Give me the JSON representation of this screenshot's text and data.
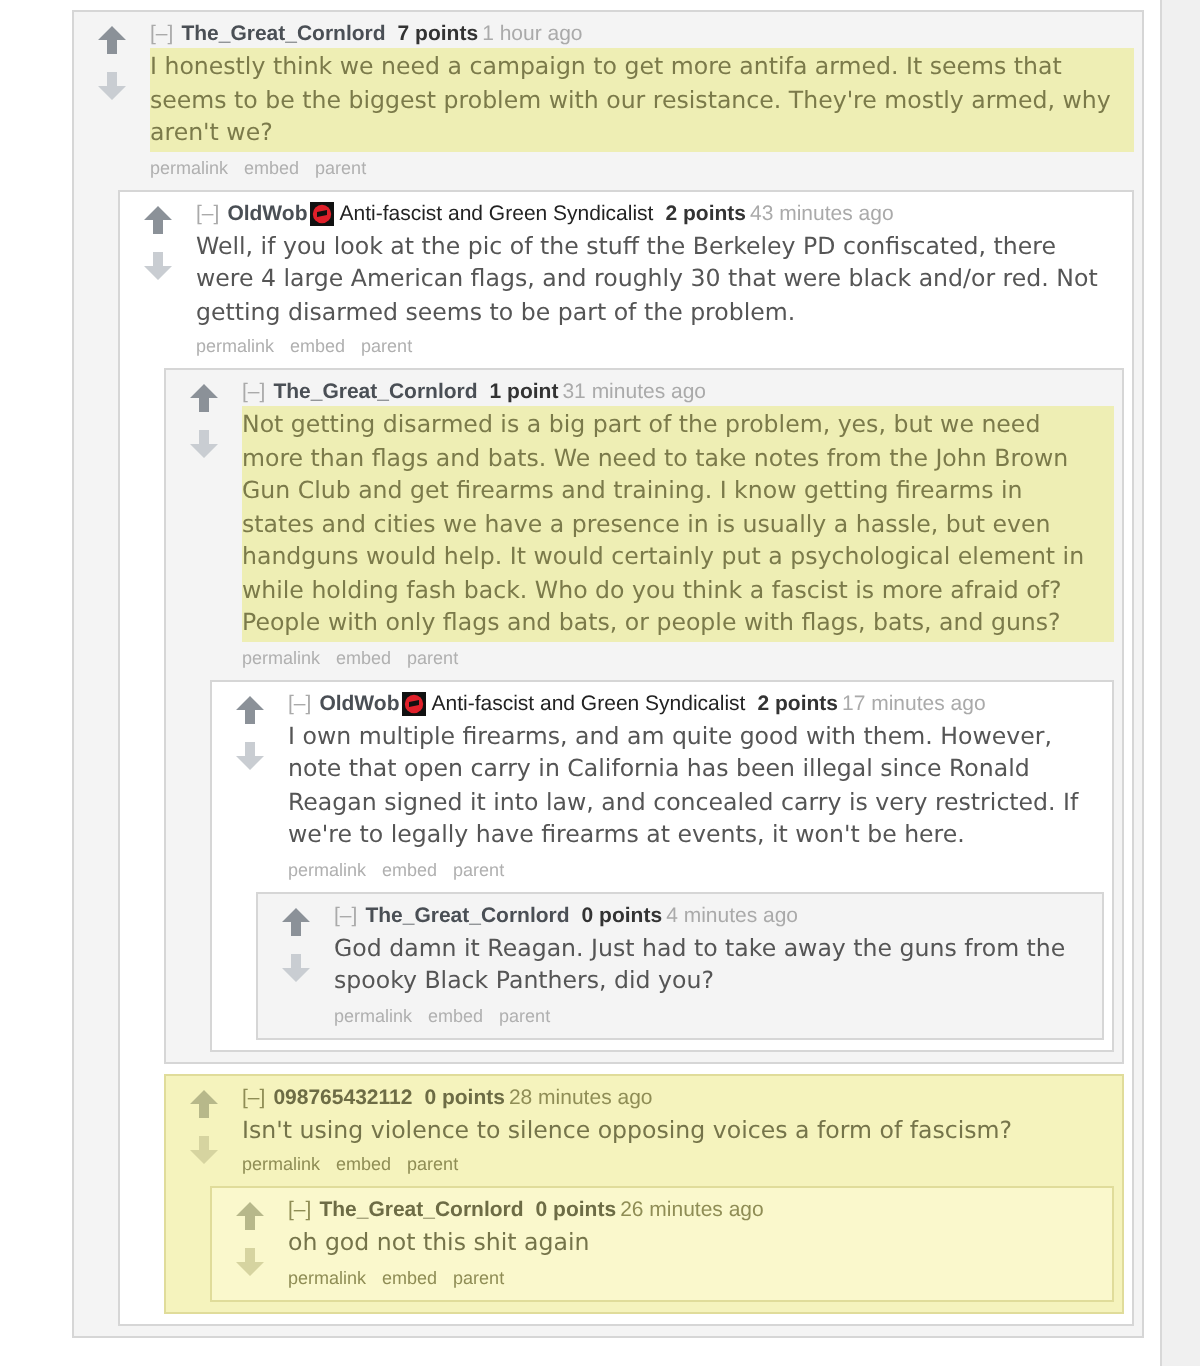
{
  "comments": [
    {
      "collapse": "[–]",
      "author": "The_Great_Cornlord",
      "points": "7 points",
      "time": "1 hour ago",
      "text_highlighted": true,
      "card_highlighted": false,
      "body": "I honestly think we need a campaign to get more antifa armed. It seems that seems to be the biggest problem with our resistance. They're mostly armed, why aren't we?",
      "actions": [
        "permalink",
        "embed",
        "parent"
      ],
      "children": [
        {
          "collapse": "[–]",
          "author": "OldWob",
          "flair": "Anti-fascist and Green Syndicalist",
          "points": "2 points",
          "time": "43 minutes ago",
          "text_highlighted": false,
          "card_highlighted": false,
          "body": "Well, if you look at the pic of the stuff the Berkeley PD confiscated, there were 4 large American flags, and roughly 30 that were black and/or red. Not getting disarmed seems to be part of the problem.",
          "actions": [
            "permalink",
            "embed",
            "parent"
          ],
          "children": [
            {
              "collapse": "[–]",
              "author": "The_Great_Cornlord",
              "points": "1 point",
              "time": "31 minutes ago",
              "text_highlighted": true,
              "card_highlighted": false,
              "body": "Not getting disarmed is a big part of the problem, yes, but we need more than flags and bats. We need to take notes from the John Brown Gun Club and get firearms and training. I know getting firearms in states and cities we have a presence in is usually a hassle, but even handguns would help. It would certainly put a psychological element in while holding fash back. Who do you think a fascist is more afraid of? People with only flags and bats, or people with flags, bats, and guns?",
              "actions": [
                "permalink",
                "embed",
                "parent"
              ],
              "children": [
                {
                  "collapse": "[–]",
                  "author": "OldWob",
                  "flair": "Anti-fascist and Green Syndicalist",
                  "points": "2 points",
                  "time": "17 minutes ago",
                  "text_highlighted": false,
                  "card_highlighted": false,
                  "body": "I own multiple firearms, and am quite good with them. However, note that open carry in California has been illegal since Ronald Reagan signed it into law, and concealed carry is very restricted. If we're to legally have firearms at events, it won't be here.",
                  "actions": [
                    "permalink",
                    "embed",
                    "parent"
                  ],
                  "children": [
                    {
                      "collapse": "[–]",
                      "author": "The_Great_Cornlord",
                      "points": "0 points",
                      "time": "4 minutes ago",
                      "text_highlighted": false,
                      "card_highlighted": false,
                      "body": "God damn it Reagan. Just had to take away the guns from the spooky Black Panthers, did you?",
                      "actions": [
                        "permalink",
                        "embed",
                        "parent"
                      ]
                    }
                  ]
                }
              ]
            },
            {
              "collapse": "[–]",
              "author": "098765432112",
              "points": "0 points",
              "time": "28 minutes ago",
              "text_highlighted": false,
              "card_highlighted": true,
              "body": "Isn't using violence to silence opposing voices a form of fascism?",
              "actions": [
                "permalink",
                "embed",
                "parent"
              ],
              "children": [
                {
                  "collapse": "[–]",
                  "author": "The_Great_Cornlord",
                  "points": "0 points",
                  "time": "26 minutes ago",
                  "text_highlighted": false,
                  "card_highlighted": true,
                  "body": "oh god not this shit again",
                  "actions": [
                    "permalink",
                    "embed",
                    "parent"
                  ]
                }
              ]
            }
          ]
        }
      ]
    }
  ]
}
